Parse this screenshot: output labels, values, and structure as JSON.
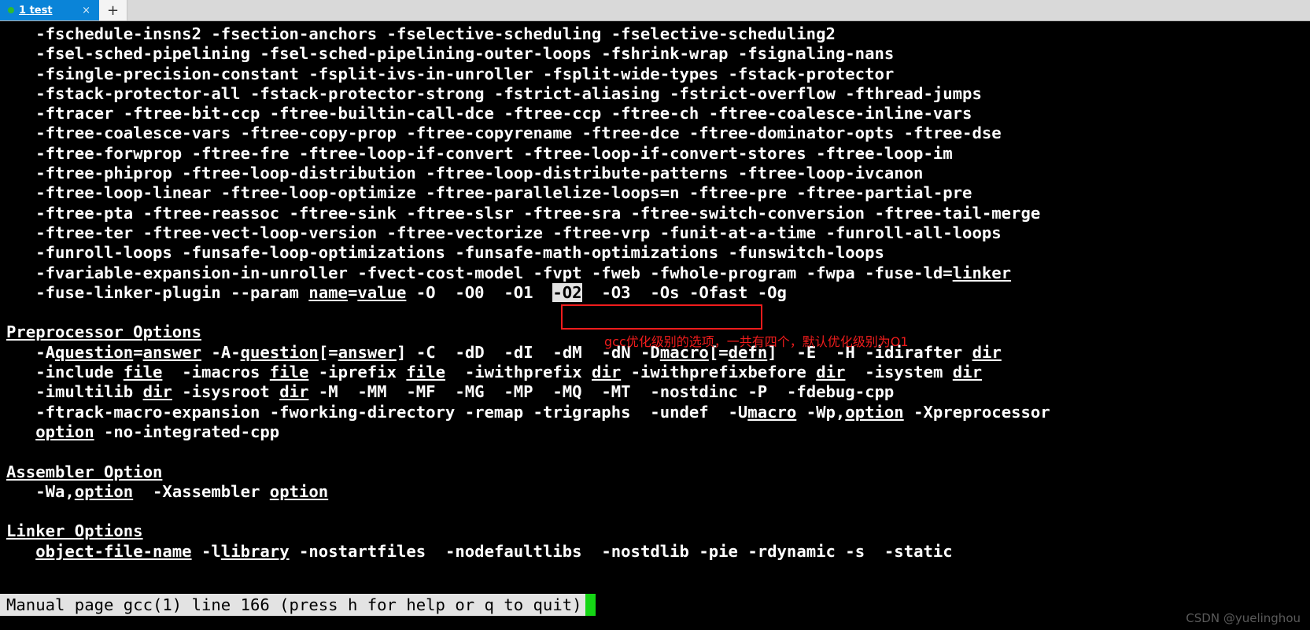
{
  "window": {
    "tab": {
      "index_label": "1",
      "title": "test",
      "close_label": "×",
      "new_tab_label": "+",
      "status_dot_color": "#2fbb2f",
      "active_color": "#0a84d8"
    }
  },
  "terminal": {
    "pager_lines": [
      "   -fschedule-insns2 -fsection-anchors -fselective-scheduling -fselective-scheduling2",
      "   -fsel-sched-pipelining -fsel-sched-pipelining-outer-loops -fshrink-wrap -fsignaling-nans",
      "   -fsingle-precision-constant -fsplit-ivs-in-unroller -fsplit-wide-types -fstack-protector",
      "   -fstack-protector-all -fstack-protector-strong -fstrict-aliasing -fstrict-overflow -fthread-jumps",
      "   -ftracer -ftree-bit-ccp -ftree-builtin-call-dce -ftree-ccp -ftree-ch -ftree-coalesce-inline-vars",
      "   -ftree-coalesce-vars -ftree-copy-prop -ftree-copyrename -ftree-dce -ftree-dominator-opts -ftree-dse",
      "   -ftree-forwprop -ftree-fre -ftree-loop-if-convert -ftree-loop-if-convert-stores -ftree-loop-im",
      "   -ftree-phiprop -ftree-loop-distribution -ftree-loop-distribute-patterns -ftree-loop-ivcanon",
      "   -ftree-loop-linear -ftree-loop-optimize -ftree-parallelize-loops=n -ftree-pre -ftree-partial-pre",
      "   -ftree-pta -ftree-reassoc -ftree-sink -ftree-slsr -ftree-sra -ftree-switch-conversion -ftree-tail-merge",
      "   -ftree-ter -ftree-vect-loop-version -ftree-vectorize -ftree-vrp -funit-at-a-time -funroll-all-loops",
      "   -funroll-loops -funsafe-loop-optimizations -funsafe-math-optimizations -funswitch-loops",
      "   -fvariable-expansion-in-unroller -fvect-cost-model -fvpt -fweb -fwhole-program -fwpa -fuse-ld=linker",
      "   -fuse-linker-plugin --param name=value -O  -O0  -O1  -O2  -O3  -Os -Ofast -Og",
      "",
      "Preprocessor Options",
      "   -Aquestion=answer -A-question[=answer] -C  -dD  -dI  -dM  -dN -Dmacro[=defn]  -E  -H -idirafter dir",
      "   -include file  -imacros file -iprefix file  -iwithprefix dir -iwithprefixbefore dir  -isystem dir",
      "   -imultilib dir -isysroot dir -M  -MM  -MF  -MG  -MP  -MQ  -MT  -nostdinc -P  -fdebug-cpp",
      "   -ftrack-macro-expansion -fworking-directory -remap -trigraphs  -undef  -Umacro -Wp,option -Xpreprocessor",
      "   option -no-integrated-cpp",
      "",
      "Assembler Option",
      "   -Wa,option  -Xassembler option",
      "",
      "Linker Options",
      "   object-file-name -llibrary -nostartfiles  -nodefaultlibs  -nostdlib -pie -rdynamic -s  -static"
    ],
    "highlighted_token": "-O2",
    "annotation": {
      "text": "gcc优化级别的选项，一共有四个，默认优化级别为O1",
      "color": "#f01c1c"
    },
    "box_label": "optimization-levels-highlight-box",
    "optimization_levels": [
      "-O0",
      "-O1",
      "-O2",
      "-O3"
    ]
  },
  "status": {
    "text": "Manual page gcc(1) line 166 (press h for help or q to quit)",
    "cursor_color": "#15d615"
  },
  "watermark": {
    "text": "CSDN @yuelinghou"
  }
}
